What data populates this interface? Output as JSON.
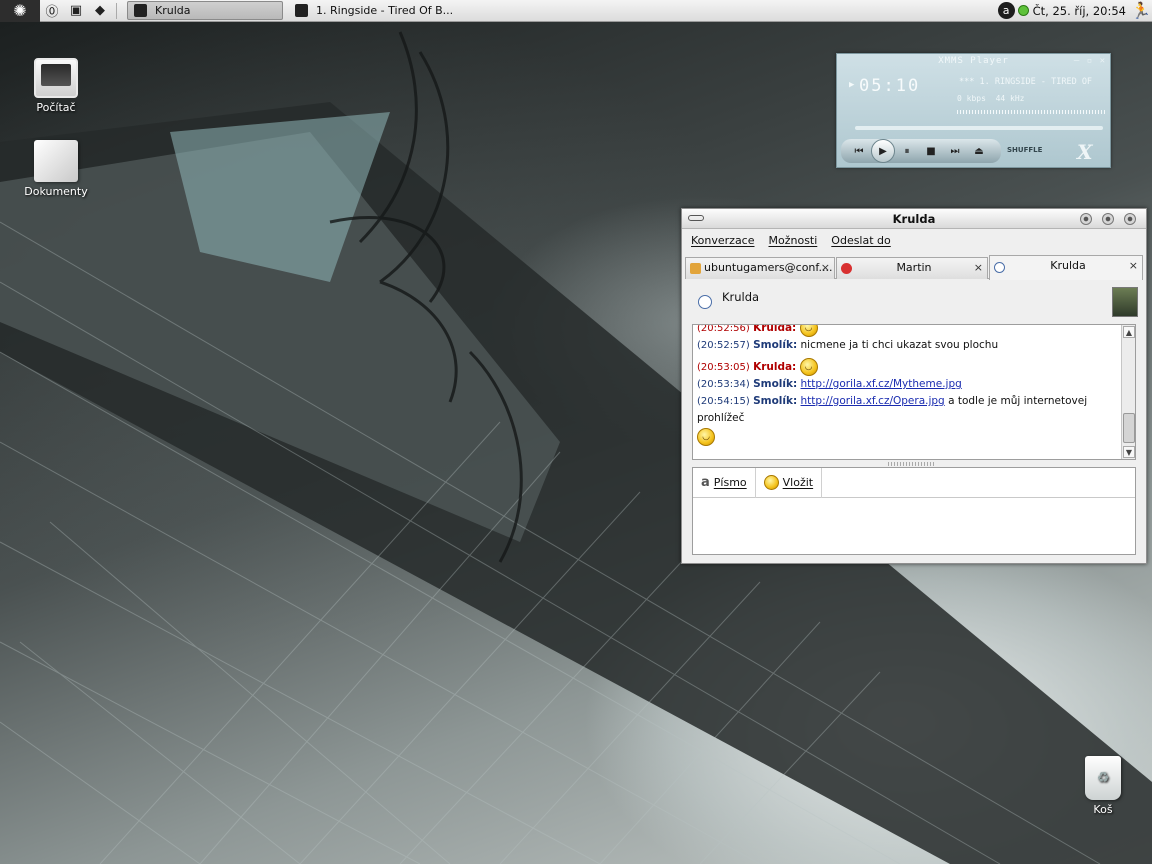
{
  "panel": {
    "tasks": [
      {
        "label": "Krulda"
      },
      {
        "label": "1. Ringside - Tired Of B..."
      }
    ],
    "clock": "Čt, 25. říj, 20:54"
  },
  "desktop": {
    "icons": [
      {
        "label": "Počítač"
      },
      {
        "label": "Dokumenty"
      },
      {
        "label": "Koš"
      }
    ]
  },
  "xmms": {
    "title": "XMMS Player",
    "time": "05:10",
    "song": "*** 1. RINGSIDE - TIRED OF",
    "kbps": "0",
    "kbps_unit": "kbps",
    "khz": "44",
    "khz_unit": "kHz",
    "shuffle_label": "SHUFFLE",
    "logo": "X"
  },
  "chat": {
    "window_title": "Krulda",
    "menu": [
      "Konverzace",
      "Možnosti",
      "Odeslat do"
    ],
    "tabs": [
      {
        "label": "ubuntugamers@conf...."
      },
      {
        "label": "Martin"
      },
      {
        "label": "Krulda"
      }
    ],
    "contact_name": "Krulda",
    "messages": [
      {
        "time": "(20:52:56)",
        "nick": "Krulda:",
        "text": "",
        "smiley": true
      },
      {
        "time": "(20:52:57)",
        "nick": "Smolík:",
        "text": "nicmene ja ti chci ukazat svou plochu"
      },
      {
        "time": "(20:53:05)",
        "nick": "Krulda:",
        "text": "",
        "smiley": true
      },
      {
        "time": "(20:53:34)",
        "nick": "Smolík:",
        "link": "http://gorila.xf.cz/Mytheme.jpg"
      },
      {
        "time": "(20:54:15)",
        "nick": "Smolík:",
        "link": "http://gorila.xf.cz/Opera.jpg",
        "text": " a todle je můj internetovej prohlížeč"
      }
    ],
    "toolbar": {
      "font_label": "Písmo",
      "insert_label": "Vložit"
    },
    "input_value": ""
  },
  "colors": {
    "own_nick": "#b00000",
    "other_nick": "#1e3a78",
    "link": "#1a2cb0"
  }
}
